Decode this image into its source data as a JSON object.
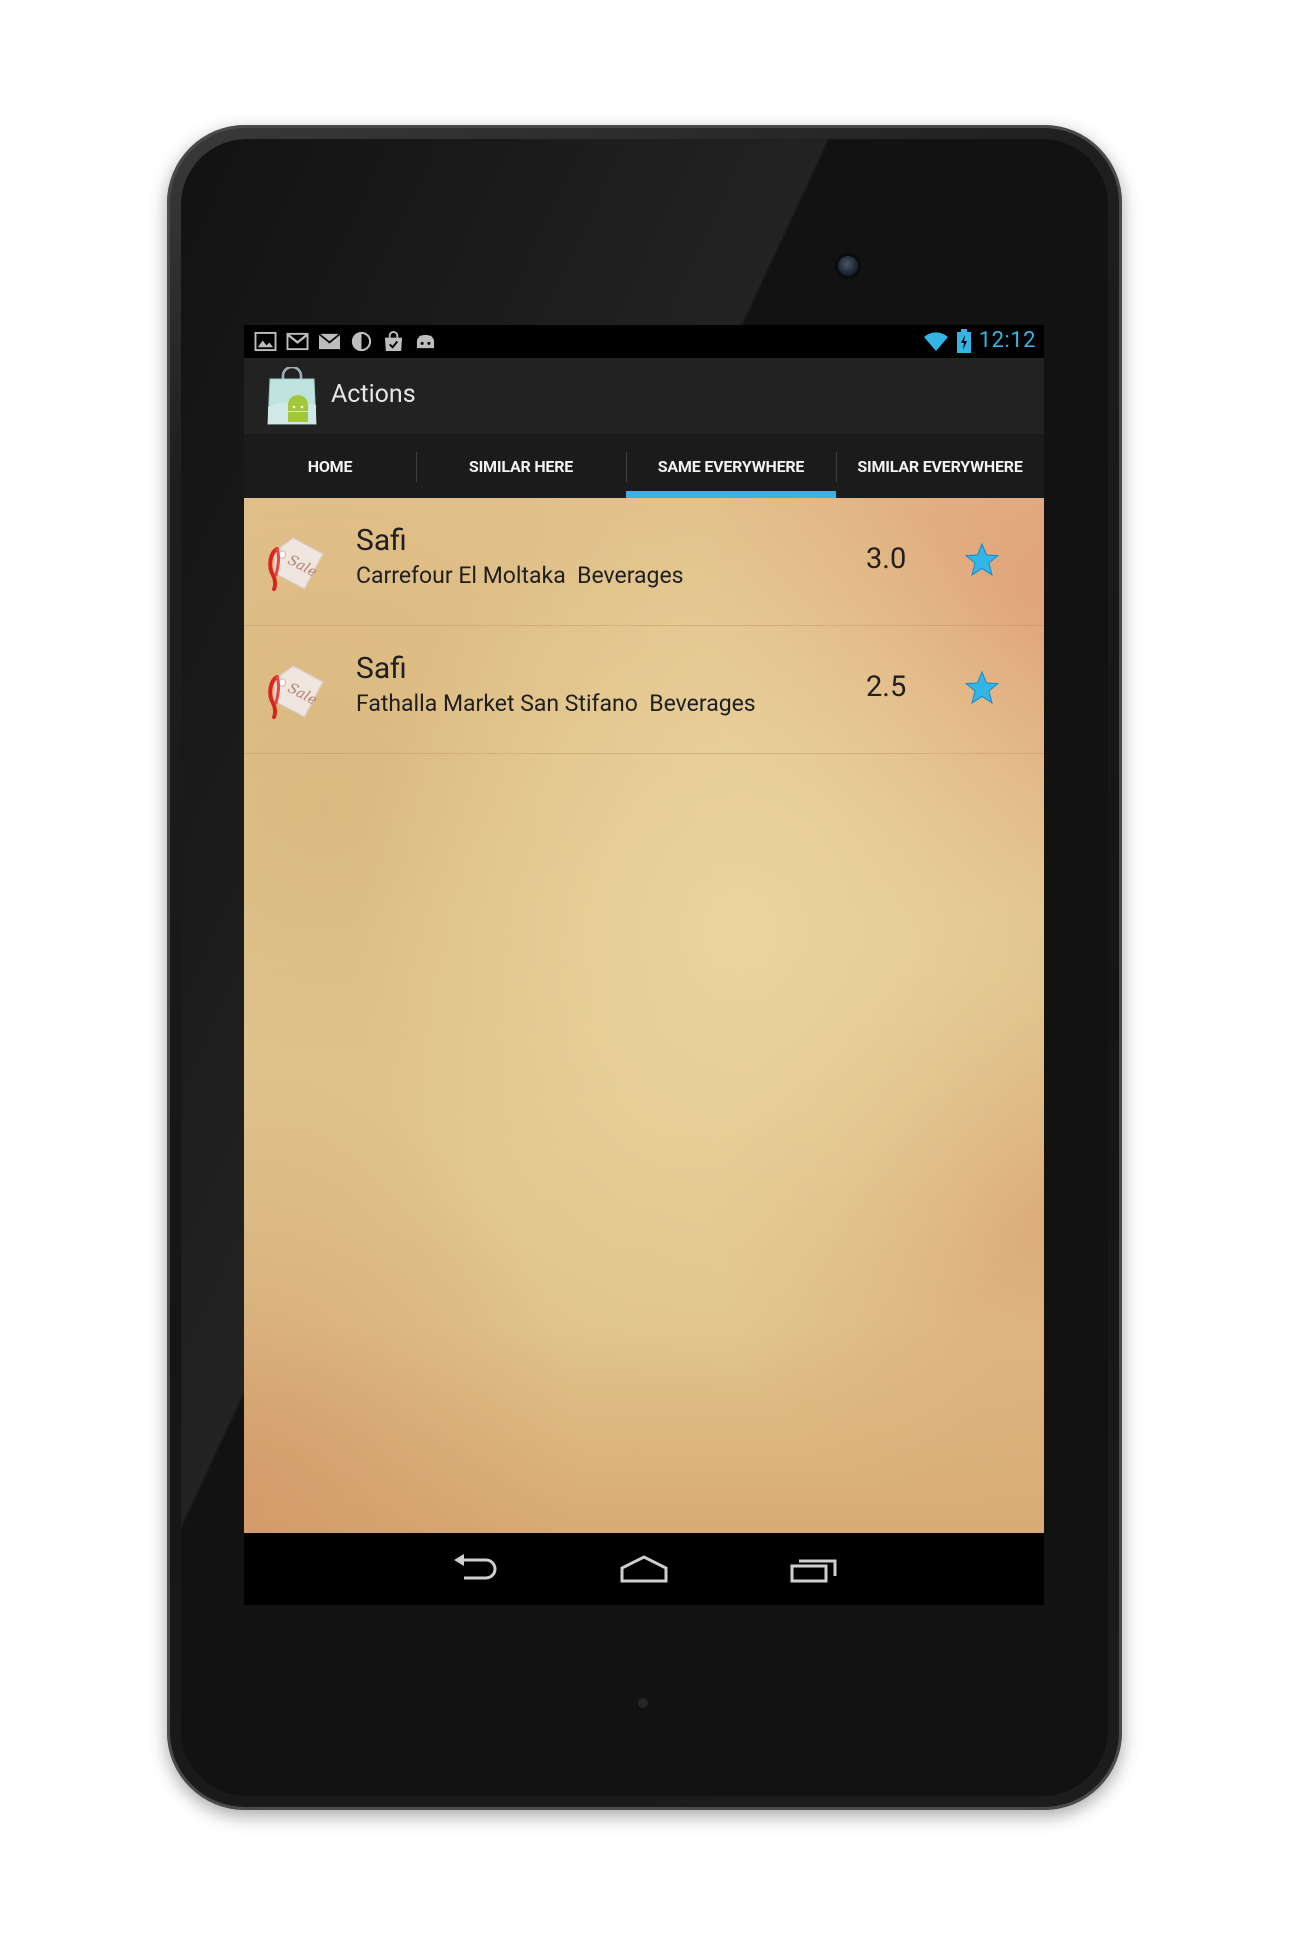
{
  "status_bar": {
    "icons": [
      "gallery-icon",
      "gmail-icon",
      "email-icon",
      "contrast-icon",
      "store-bag-icon",
      "android-icon"
    ],
    "time": "12:12",
    "accent_color": "#33b5e5"
  },
  "action_bar": {
    "title": "Actions"
  },
  "tabs": [
    {
      "label": "HOME",
      "active": false
    },
    {
      "label": "SIMILAR HERE",
      "active": false
    },
    {
      "label": "SAME EVERYWHERE",
      "active": true
    },
    {
      "label": "SIMILAR EVERYWHERE",
      "active": false
    }
  ],
  "items": [
    {
      "title": "Safi",
      "subtitle": "Carrefour El Moltaka  Beverages",
      "rating": "3.0",
      "icon": "sale-tag-icon"
    },
    {
      "title": "Safi",
      "subtitle": "Fathalla Market San Stifano  Beverages",
      "rating": "2.5",
      "icon": "sale-tag-icon"
    }
  ],
  "nav_bar": {
    "buttons": [
      "back-icon",
      "home-icon",
      "recent-apps-icon"
    ]
  }
}
